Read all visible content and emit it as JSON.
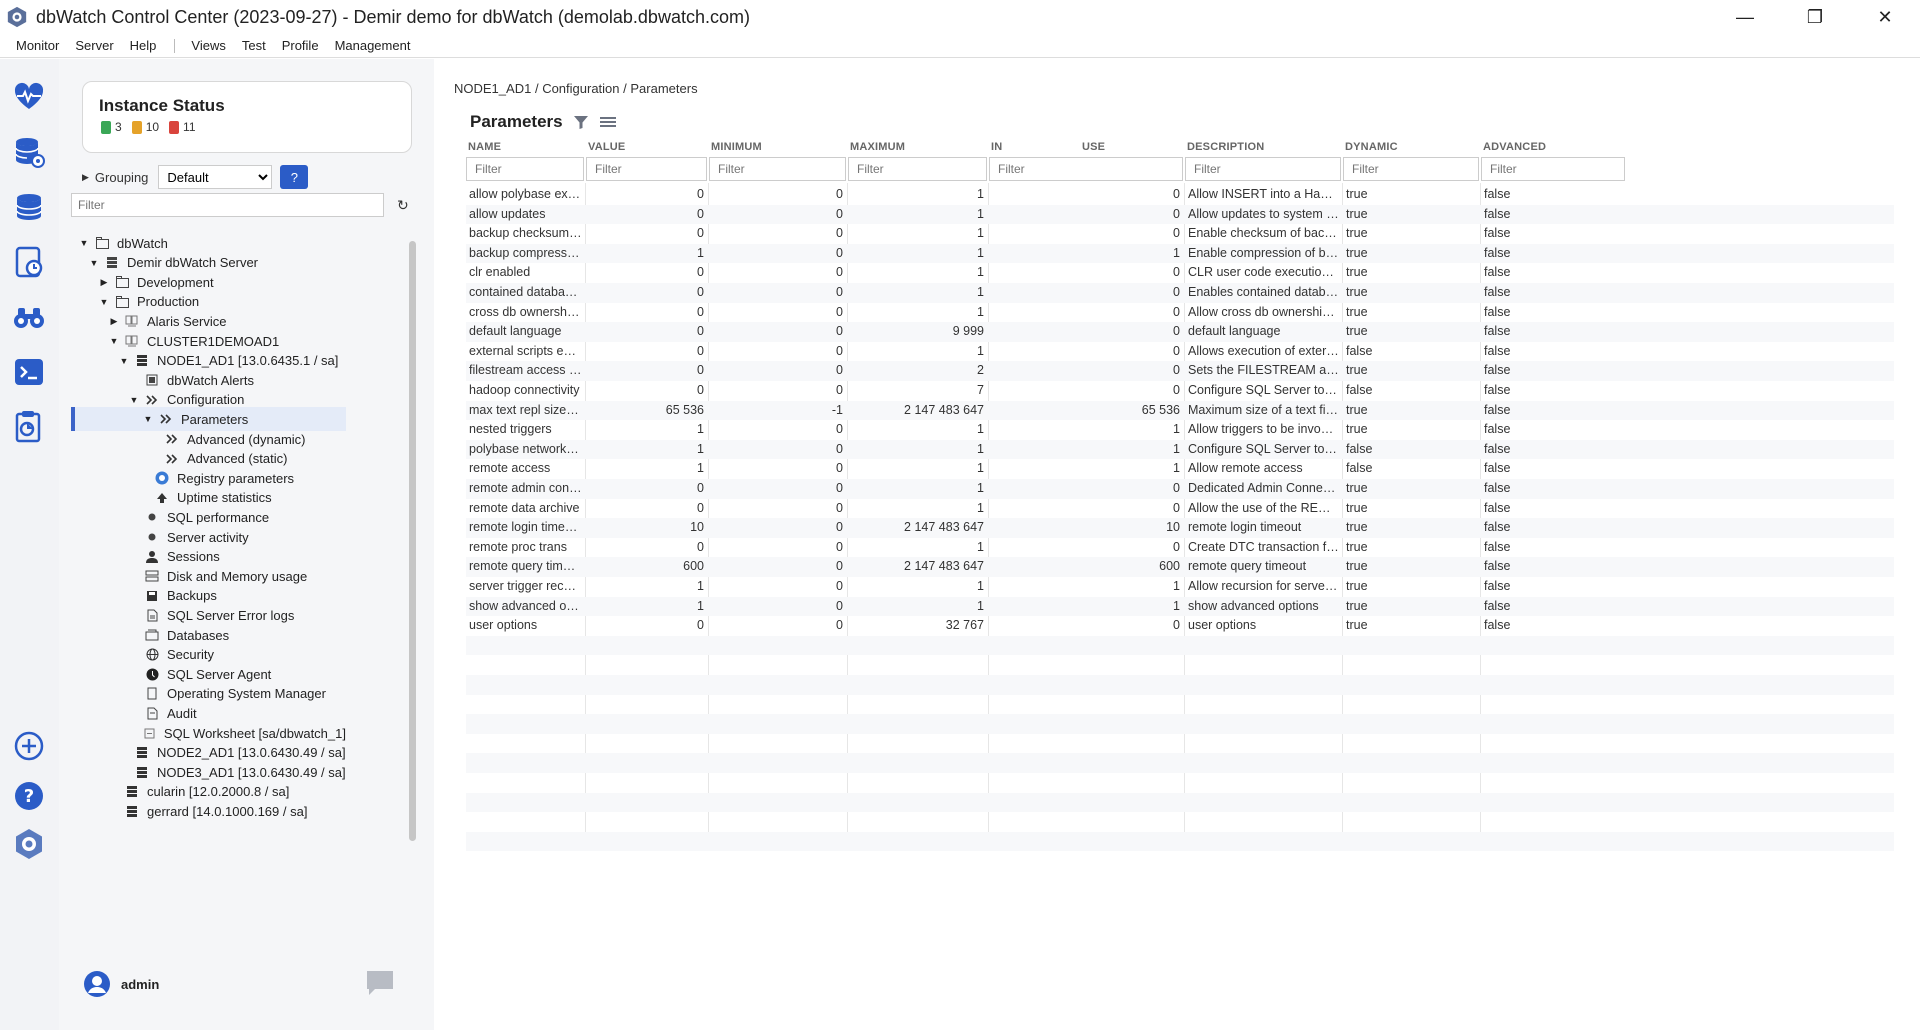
{
  "window": {
    "title": "dbWatch Control Center  (2023-09-27) - Demir demo for dbWatch (demolab.dbwatch.com)",
    "minimize": "—",
    "maximize": "❐",
    "close": "✕"
  },
  "menu": [
    "Monitor",
    "Server",
    "Help",
    "Views",
    "Test",
    "Profile",
    "Management"
  ],
  "iconbar": [
    "heartbeat-icon",
    "database-settings-icon",
    "database-stack-icon",
    "database-clock-icon",
    "binoculars-icon",
    "terminal-icon",
    "report-icon",
    "add-icon",
    "help-icon",
    "dbwatch-logo-icon"
  ],
  "instance_status": {
    "title": "Instance Status",
    "green_count": "3",
    "yellow_count": "10",
    "red_count": "11",
    "colors": {
      "green": "#3aa757",
      "yellow": "#e5a229",
      "red": "#d9443c"
    }
  },
  "grouping": {
    "label": "Grouping",
    "value": "Default",
    "help": "?"
  },
  "tree_filter": {
    "placeholder": "Filter"
  },
  "tree": [
    {
      "label": "dbWatch",
      "depth": 0,
      "twisty": "▼",
      "icon": "folder"
    },
    {
      "label": "Demir dbWatch Server",
      "depth": 1,
      "twisty": "▼",
      "icon": "server"
    },
    {
      "label": "Development",
      "depth": 2,
      "twisty": "▶",
      "icon": "folder"
    },
    {
      "label": "Production",
      "depth": 2,
      "twisty": "▼",
      "icon": "folder"
    },
    {
      "label": "Alaris Service",
      "depth": 3,
      "twisty": "▶",
      "icon": "cluster"
    },
    {
      "label": "CLUSTER1DEMOAD1",
      "depth": 3,
      "twisty": "▼",
      "icon": "cluster"
    },
    {
      "label": "NODE1_AD1 [13.0.6435.1 / sa]",
      "depth": 4,
      "twisty": "▼",
      "icon": "db"
    },
    {
      "label": "dbWatch Alerts",
      "depth": 5,
      "twisty": "",
      "icon": "alerts"
    },
    {
      "label": "Configuration",
      "depth": 5,
      "twisty": "▼",
      "icon": "config"
    },
    {
      "label": "Parameters",
      "depth": 6,
      "twisty": "▼",
      "icon": "config",
      "selected": true
    },
    {
      "label": "Advanced (dynamic)",
      "depth": 7,
      "twisty": "",
      "icon": "config"
    },
    {
      "label": "Advanced (static)",
      "depth": 7,
      "twisty": "",
      "icon": "config"
    },
    {
      "label": "Registry parameters",
      "depth": 6,
      "twisty": "",
      "icon": "registry"
    },
    {
      "label": "Uptime statistics",
      "depth": 6,
      "twisty": "",
      "icon": "uptime"
    },
    {
      "label": "SQL performance",
      "depth": 5,
      "twisty": "",
      "icon": "dot"
    },
    {
      "label": "Server activity",
      "depth": 5,
      "twisty": "",
      "icon": "dot"
    },
    {
      "label": "Sessions",
      "depth": 5,
      "twisty": "",
      "icon": "user"
    },
    {
      "label": "Disk and Memory usage",
      "depth": 5,
      "twisty": "",
      "icon": "disk"
    },
    {
      "label": "Backups",
      "depth": 5,
      "twisty": "",
      "icon": "backup"
    },
    {
      "label": "SQL Server Error logs",
      "depth": 5,
      "twisty": "",
      "icon": "log"
    },
    {
      "label": "Databases",
      "depth": 5,
      "twisty": "",
      "icon": "dbs"
    },
    {
      "label": "Security",
      "depth": 5,
      "twisty": "",
      "icon": "globe"
    },
    {
      "label": "SQL Server Agent",
      "depth": 5,
      "twisty": "",
      "icon": "agent"
    },
    {
      "label": "Operating System Manager",
      "depth": 5,
      "twisty": "",
      "icon": "os"
    },
    {
      "label": "Audit",
      "depth": 5,
      "twisty": "",
      "icon": "audit"
    },
    {
      "label": "SQL Worksheet [sa/dbwatch_1]",
      "depth": 5,
      "twisty": "",
      "icon": "sheet"
    },
    {
      "label": "NODE2_AD1 [13.0.6430.49 / sa]",
      "depth": 4,
      "twisty": "",
      "icon": "db"
    },
    {
      "label": "NODE3_AD1 [13.0.6430.49 / sa]",
      "depth": 4,
      "twisty": "",
      "icon": "db"
    },
    {
      "label": "cularin [12.0.2000.8 / sa]",
      "depth": 3,
      "twisty": "",
      "icon": "db"
    },
    {
      "label": "gerrard [14.0.1000.169 / sa]",
      "depth": 3,
      "twisty": "",
      "icon": "db"
    }
  ],
  "user": {
    "name": "admin"
  },
  "breadcrumb": {
    "a": "NODE1_AD1",
    "b": "Configuration",
    "c": "Parameters",
    "sep": "/"
  },
  "params": {
    "title": "Parameters",
    "columns": [
      "NAME",
      "VALUE",
      "MINIMUM",
      "MAXIMUM",
      "IN",
      "USE",
      "DESCRIPTION",
      "DYNAMIC",
      "ADVANCED"
    ],
    "filter_placeholder": "Filter",
    "rows": [
      [
        "allow polybase export",
        "0",
        "0",
        "1",
        "0",
        "Allow INSERT into a Hadoop ...",
        "true",
        "false"
      ],
      [
        "allow updates",
        "0",
        "0",
        "1",
        "0",
        "Allow updates to system tables",
        "true",
        "false"
      ],
      [
        "backup checksum de...",
        "0",
        "0",
        "1",
        "0",
        "Enable checksum of backups...",
        "true",
        "false"
      ],
      [
        "backup compression ...",
        "1",
        "0",
        "1",
        "1",
        "Enable compression of backu...",
        "true",
        "false"
      ],
      [
        "clr enabled",
        "0",
        "0",
        "1",
        "0",
        "CLR user code execution ena...",
        "true",
        "false"
      ],
      [
        "contained database a...",
        "0",
        "0",
        "1",
        "0",
        "Enables contained databases...",
        "true",
        "false"
      ],
      [
        "cross db ownership c...",
        "0",
        "0",
        "1",
        "0",
        "Allow cross db ownership ch...",
        "true",
        "false"
      ],
      [
        "default language",
        "0",
        "0",
        "9 999",
        "0",
        "default language",
        "true",
        "false"
      ],
      [
        "external scripts enabl...",
        "0",
        "0",
        "1",
        "0",
        "Allows execution of external s...",
        "false",
        "false"
      ],
      [
        "filestream access level",
        "0",
        "0",
        "2",
        "0",
        "Sets the FILESTREAM access l...",
        "true",
        "false"
      ],
      [
        "hadoop connectivity",
        "0",
        "0",
        "7",
        "0",
        "Configure SQL Server to conn...",
        "false",
        "false"
      ],
      [
        "max text repl size (B)",
        "65 536",
        "-1",
        "2 147 483 647",
        "65 536",
        "Maximum size of a text field i...",
        "true",
        "false"
      ],
      [
        "nested triggers",
        "1",
        "0",
        "1",
        "1",
        "Allow triggers to be invoked ...",
        "true",
        "false"
      ],
      [
        "polybase network en...",
        "1",
        "0",
        "1",
        "1",
        "Configure SQL Server to encr...",
        "false",
        "false"
      ],
      [
        "remote access",
        "1",
        "0",
        "1",
        "1",
        "Allow remote access",
        "false",
        "false"
      ],
      [
        "remote admin conne...",
        "0",
        "0",
        "1",
        "0",
        "Dedicated Admin Connectio...",
        "true",
        "false"
      ],
      [
        "remote data archive",
        "0",
        "0",
        "1",
        "0",
        "Allow the use of the REMOTE...",
        "true",
        "false"
      ],
      [
        "remote login timeout...",
        "10",
        "0",
        "2 147 483 647",
        "10",
        "remote login timeout",
        "true",
        "false"
      ],
      [
        "remote proc trans",
        "0",
        "0",
        "1",
        "0",
        "Create DTC transaction for re...",
        "true",
        "false"
      ],
      [
        "remote query timeou...",
        "600",
        "0",
        "2 147 483 647",
        "600",
        "remote query timeout",
        "true",
        "false"
      ],
      [
        "server trigger recursion",
        "1",
        "0",
        "1",
        "1",
        "Allow recursion for server lev...",
        "true",
        "false"
      ],
      [
        "show advanced optio...",
        "1",
        "0",
        "1",
        "1",
        "show advanced options",
        "true",
        "false"
      ],
      [
        "user options",
        "0",
        "0",
        "32 767",
        "0",
        "user options",
        "true",
        "false"
      ]
    ],
    "empty_rows": 11
  }
}
